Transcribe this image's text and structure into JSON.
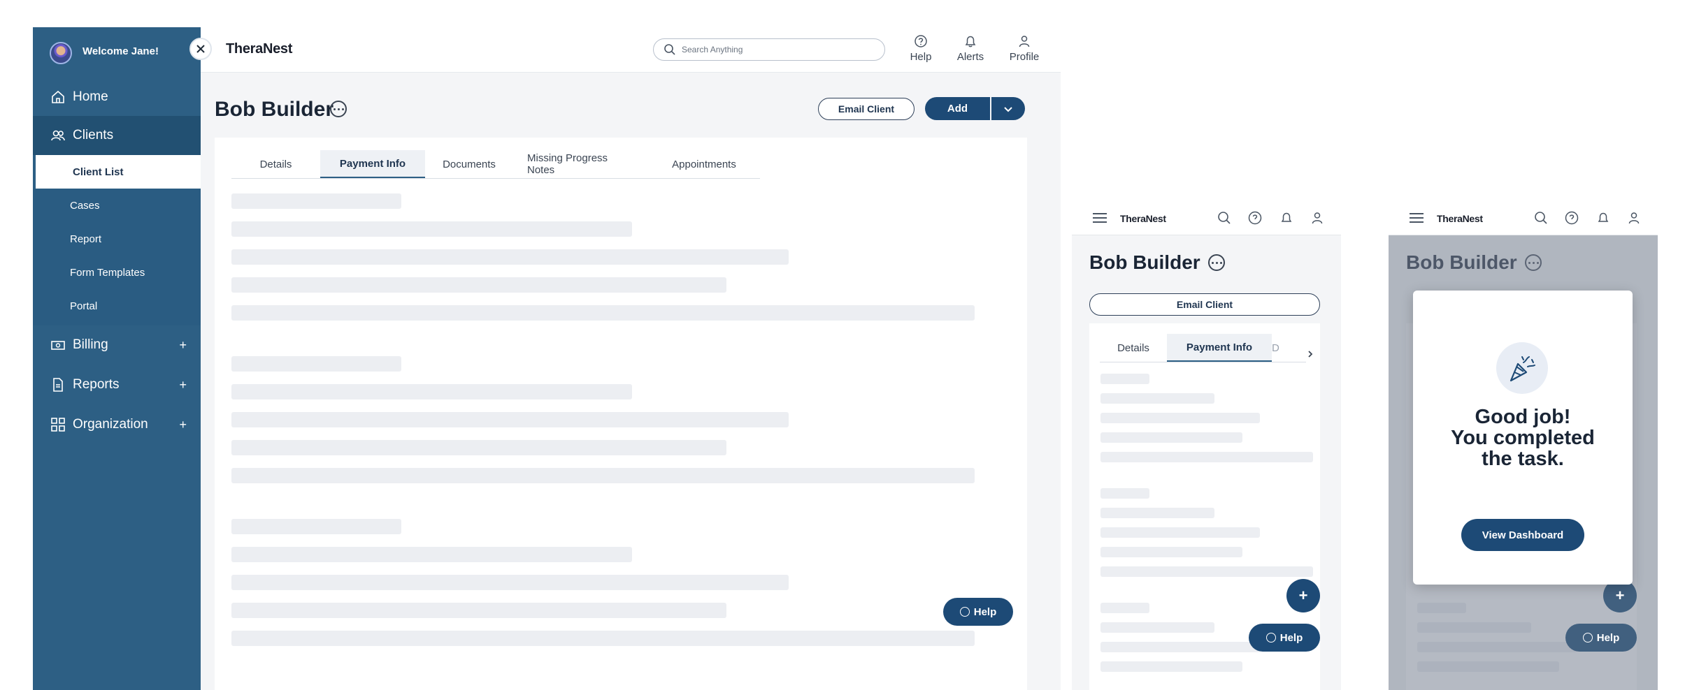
{
  "desktop": {
    "sidebar": {
      "welcome": "Welcome Jane!",
      "items": [
        {
          "label": "Home",
          "icon": "home-icon"
        },
        {
          "label": "Clients",
          "icon": "clients-icon"
        },
        {
          "label": "Billing",
          "icon": "billing-icon",
          "expand": "+"
        },
        {
          "label": "Reports",
          "icon": "reports-icon",
          "expand": "+"
        },
        {
          "label": "Organization",
          "icon": "organization-icon",
          "expand": "+"
        }
      ],
      "client_subitems": [
        "Client List",
        "Cases",
        "Report",
        "Form Templates",
        "Portal"
      ],
      "selected_subitem": "Client List"
    },
    "header": {
      "brand": "TheraNest",
      "search_placeholder": "Search Anything",
      "buttons": [
        "Help",
        "Alerts",
        "Profile"
      ]
    },
    "client": {
      "name": "Bob Builder",
      "email_button": "Email Client",
      "add_button": "Add"
    },
    "tabs": [
      "Details",
      "Payment Info",
      "Documents",
      "Missing Progress Notes",
      "Appointments"
    ],
    "active_tab": "Payment Info",
    "help_button": "Help"
  },
  "mobile": {
    "brand": "TheraNest",
    "client_name": "Bob Builder",
    "email_button": "Email Client",
    "tabs": [
      "Details",
      "Payment Info",
      "D"
    ],
    "help_button": "Help",
    "plus_label": "+"
  },
  "modal": {
    "title_lines": [
      "Good job!",
      "You completed",
      "the task."
    ],
    "button": "View Dashboard"
  },
  "colors": {
    "sidebar": "#2d5f84",
    "primary": "#1d4a76",
    "skeleton": "#eceef2"
  }
}
